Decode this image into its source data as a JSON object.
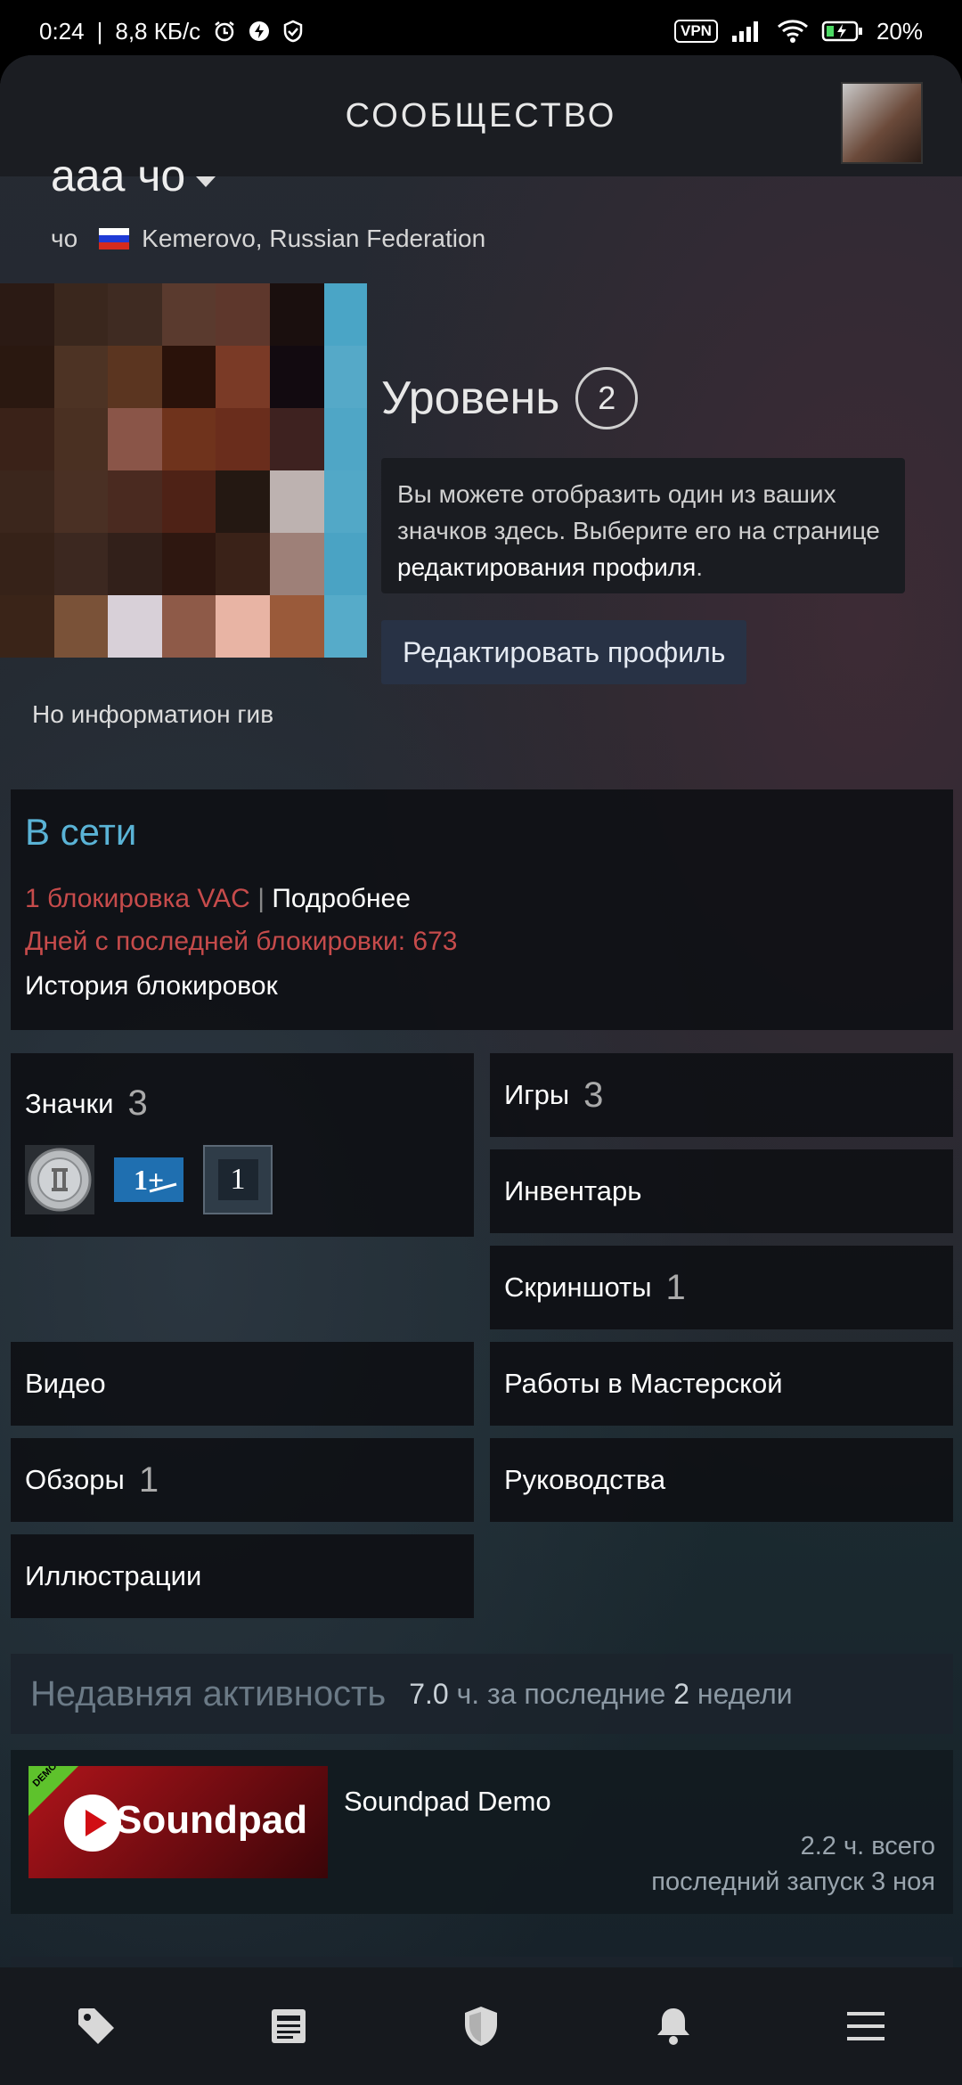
{
  "statusbar": {
    "time": "0:24",
    "speed": "8,8 КБ/с",
    "vpn": "VPN",
    "battery": "20%"
  },
  "header": {
    "title": "СООБЩЕСТВО"
  },
  "profile": {
    "name": "ааа чо",
    "realname": "чо",
    "location": "Kemerovo, Russian Federation",
    "level_label": "Уровень",
    "level_value": "2",
    "badge_info_prefix": "Вы можете отобразить один из ваших значков здесь. Выберите его на странице ",
    "badge_info_link": "редактирования профиля",
    "badge_info_suffix": ".",
    "edit_button": "Редактировать профиль",
    "summary": "Но информатион гив"
  },
  "status": {
    "online": "В сети",
    "vac": "1 блокировка VAC",
    "vac_separator": "|",
    "vac_more": "Подробнее",
    "days_since": "Дней с последней блокировки: 673",
    "ban_history": "История блокировок"
  },
  "tiles": {
    "badges": {
      "label": "Значки",
      "count": "3",
      "badge3_text": "1"
    },
    "games": {
      "label": "Игры",
      "count": "3"
    },
    "inventory": {
      "label": "Инвентарь"
    },
    "screenshots": {
      "label": "Скриншоты",
      "count": "1"
    },
    "videos": {
      "label": "Видео"
    },
    "workshop": {
      "label": "Работы в Мастерской"
    },
    "reviews": {
      "label": "Обзоры",
      "count": "1"
    },
    "guides": {
      "label": "Руководства"
    },
    "artwork": {
      "label": "Иллюстрации"
    }
  },
  "activity": {
    "title": "Недавняя активность",
    "hours_value": "7.0",
    "hours_unit": "ч. за последние",
    "weeks_value": "2",
    "weeks_unit": "недели"
  },
  "game": {
    "name": "Soundpad Demo",
    "thumb_text": "Soundpad",
    "demo_tag": "DEMO",
    "total": "2.2 ч. всего",
    "last_played": "последний запуск 3 ноя"
  },
  "nav_icons": [
    "tag-icon",
    "news-icon",
    "shield-icon",
    "bell-icon",
    "menu-icon"
  ]
}
